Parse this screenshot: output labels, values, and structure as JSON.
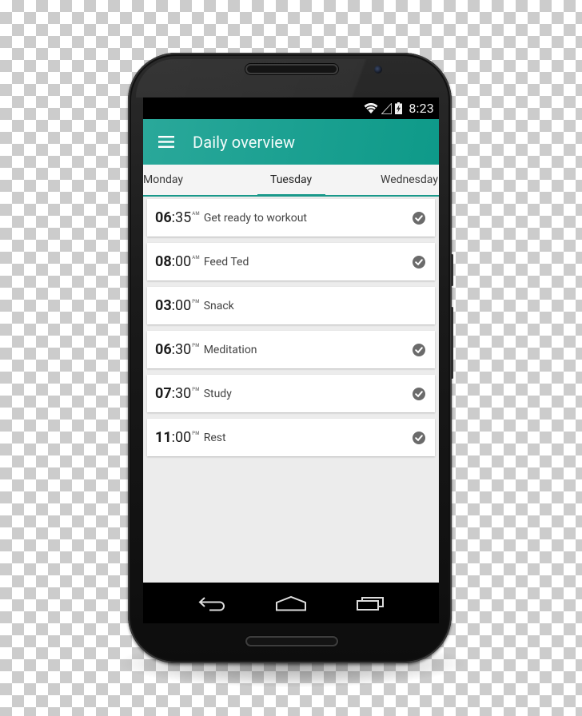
{
  "status_bar": {
    "time": "8:23",
    "icons": [
      "wifi-icon",
      "cell-signal-icon",
      "battery-charging-icon"
    ]
  },
  "app_bar": {
    "menu_icon": "hamburger-menu-icon",
    "title": "Daily overview",
    "color": "#1ea293"
  },
  "tabs": {
    "items": [
      {
        "label": "Monday",
        "active": false
      },
      {
        "label": "Tuesday",
        "active": true
      },
      {
        "label": "Wednesday",
        "active": false
      }
    ],
    "indicator_color": "#19988a"
  },
  "schedule": [
    {
      "hour": "06",
      "minute": ":35",
      "ampm": "AM",
      "label": "Get ready to workout",
      "done": true
    },
    {
      "hour": "08",
      "minute": ":00",
      "ampm": "AM",
      "label": "Feed Ted",
      "done": true
    },
    {
      "hour": "03",
      "minute": ":00",
      "ampm": "PM",
      "label": "Snack",
      "done": false
    },
    {
      "hour": "06",
      "minute": ":30",
      "ampm": "PM",
      "label": "Meditation",
      "done": true
    },
    {
      "hour": "07",
      "minute": ":30",
      "ampm": "PM",
      "label": "Study",
      "done": true
    },
    {
      "hour": "11",
      "minute": ":00",
      "ampm": "PM",
      "label": "Rest",
      "done": true
    }
  ],
  "nav_bar": {
    "buttons": [
      "back-icon",
      "home-icon",
      "recent-apps-icon"
    ]
  }
}
